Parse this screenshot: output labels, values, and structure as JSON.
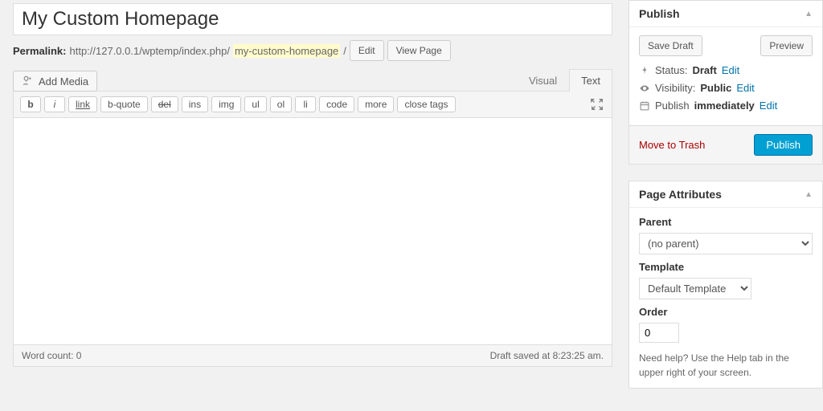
{
  "title": "My Custom Homepage",
  "permalink": {
    "label": "Permalink:",
    "base": "http://127.0.0.1/wptemp/index.php/",
    "slug": "my-custom-homepage",
    "sep": "/",
    "edit": "Edit",
    "view": "View Page"
  },
  "media": {
    "add": "Add Media"
  },
  "tabs": {
    "visual": "Visual",
    "text": "Text"
  },
  "qt": {
    "b": "b",
    "i": "i",
    "link": "link",
    "bquote": "b-quote",
    "del": "del",
    "ins": "ins",
    "img": "img",
    "ul": "ul",
    "ol": "ol",
    "li": "li",
    "code": "code",
    "more": "more",
    "close": "close tags"
  },
  "status_bar": {
    "wordcount": "Word count: 0",
    "saved": "Draft saved at 8:23:25 am."
  },
  "publish": {
    "title": "Publish",
    "save_draft": "Save Draft",
    "preview": "Preview",
    "status_label": "Status:",
    "status_value": "Draft",
    "status_edit": "Edit",
    "visibility_label": "Visibility:",
    "visibility_value": "Public",
    "visibility_edit": "Edit",
    "schedule_label": "Publish",
    "schedule_value": "immediately",
    "schedule_edit": "Edit",
    "trash": "Move to Trash",
    "publish_btn": "Publish"
  },
  "attrs": {
    "title": "Page Attributes",
    "parent_label": "Parent",
    "parent_value": "(no parent)",
    "template_label": "Template",
    "template_value": "Default Template",
    "order_label": "Order",
    "order_value": "0",
    "help": "Need help? Use the Help tab in the upper right of your screen."
  }
}
